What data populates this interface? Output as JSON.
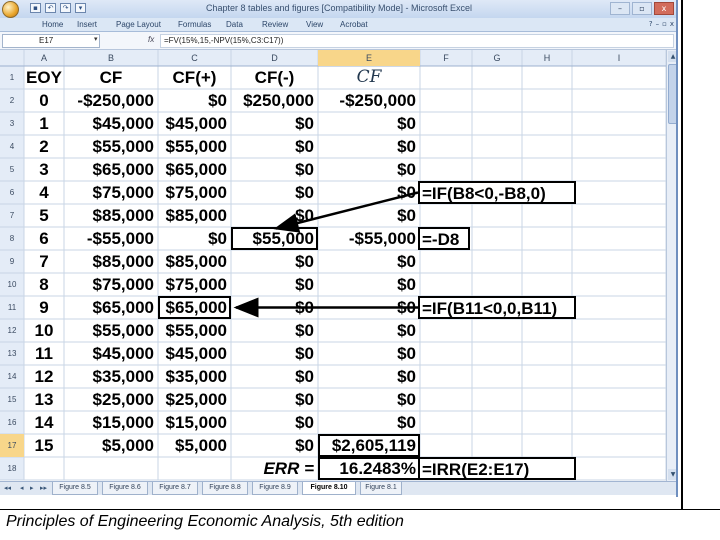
{
  "window": {
    "title": "Chapter 8 tables and figures [Compatibility Mode] - Microsoft Excel",
    "qat_icons": [
      "save-icon",
      "undo-icon",
      "redo-icon",
      "customize-qat-icon"
    ],
    "controls": {
      "minimize": "–",
      "restore": "▫",
      "close": "x"
    }
  },
  "ribbon": {
    "tabs": [
      "Home",
      "Insert",
      "Page Layout",
      "Formulas",
      "Data",
      "Review",
      "View",
      "Acrobat"
    ],
    "controls": [
      "?",
      "–",
      "▫",
      "x"
    ]
  },
  "formula_bar": {
    "name_box": "E17",
    "fx": "fx",
    "formula": "=FV(15%,15,-NPV(15%,C3:C17))"
  },
  "columns": [
    "A",
    "B",
    "C",
    "D",
    "E",
    "F",
    "G",
    "H",
    "I"
  ],
  "selected_column": "E",
  "selected_row": "17",
  "rows": [
    {
      "n": "1",
      "A": "EOY",
      "B": "CF",
      "C": "CF(+)",
      "D": "CF(-)",
      "E": "CF"
    },
    {
      "n": "2",
      "A": "0",
      "B": "-$250,000",
      "C": "$0",
      "D": "$250,000",
      "E": "-$250,000"
    },
    {
      "n": "3",
      "A": "1",
      "B": "$45,000",
      "C": "$45,000",
      "D": "$0",
      "E": "$0"
    },
    {
      "n": "4",
      "A": "2",
      "B": "$55,000",
      "C": "$55,000",
      "D": "$0",
      "E": "$0"
    },
    {
      "n": "5",
      "A": "3",
      "B": "$65,000",
      "C": "$65,000",
      "D": "$0",
      "E": "$0"
    },
    {
      "n": "6",
      "A": "4",
      "B": "$75,000",
      "C": "$75,000",
      "D": "$0",
      "E": "$0"
    },
    {
      "n": "7",
      "A": "5",
      "B": "$85,000",
      "C": "$85,000",
      "D": "$0",
      "E": "$0"
    },
    {
      "n": "8",
      "A": "6",
      "B": "-$55,000",
      "C": "$0",
      "D": "$55,000",
      "E": "-$55,000"
    },
    {
      "n": "9",
      "A": "7",
      "B": "$85,000",
      "C": "$85,000",
      "D": "$0",
      "E": "$0"
    },
    {
      "n": "10",
      "A": "8",
      "B": "$75,000",
      "C": "$75,000",
      "D": "$0",
      "E": "$0"
    },
    {
      "n": "11",
      "A": "9",
      "B": "$65,000",
      "C": "$65,000",
      "D": "$0",
      "E": "$0"
    },
    {
      "n": "12",
      "A": "10",
      "B": "$55,000",
      "C": "$55,000",
      "D": "$0",
      "E": "$0"
    },
    {
      "n": "13",
      "A": "11",
      "B": "$45,000",
      "C": "$45,000",
      "D": "$0",
      "E": "$0"
    },
    {
      "n": "14",
      "A": "12",
      "B": "$35,000",
      "C": "$35,000",
      "D": "$0",
      "E": "$0"
    },
    {
      "n": "15",
      "A": "13",
      "B": "$25,000",
      "C": "$25,000",
      "D": "$0",
      "E": "$0"
    },
    {
      "n": "16",
      "A": "14",
      "B": "$15,000",
      "C": "$15,000",
      "D": "$0",
      "E": "$0"
    },
    {
      "n": "17",
      "A": "15",
      "B": "$5,000",
      "C": "$5,000",
      "D": "$0",
      "E": "$2,605,119"
    },
    {
      "n": "18",
      "A": "",
      "B": "",
      "C": "",
      "D": "ERR =",
      "E": "16.2483%"
    }
  ],
  "annotations": [
    {
      "row": "6",
      "text": "=IF(B8<0,-B8,0)"
    },
    {
      "row": "8",
      "text": "=-D8"
    },
    {
      "row": "11",
      "text": "=IF(B11<0,0,B11)"
    },
    {
      "row": "18",
      "text": "=IRR(E2:E17)"
    }
  ],
  "sheet_tabs": [
    "Figure 8.5",
    "Figure 8.6",
    "Figure 8.7",
    "Figure 8.8",
    "Figure 8.9",
    "Figure 8.10",
    "Figure 8.1"
  ],
  "active_sheet": "Figure 8.10",
  "sheet_nav": [
    "◂◂",
    "◂",
    "▸",
    "▸▸"
  ],
  "footer": "Principles of Engineering Economic Analysis, 5th edition"
}
